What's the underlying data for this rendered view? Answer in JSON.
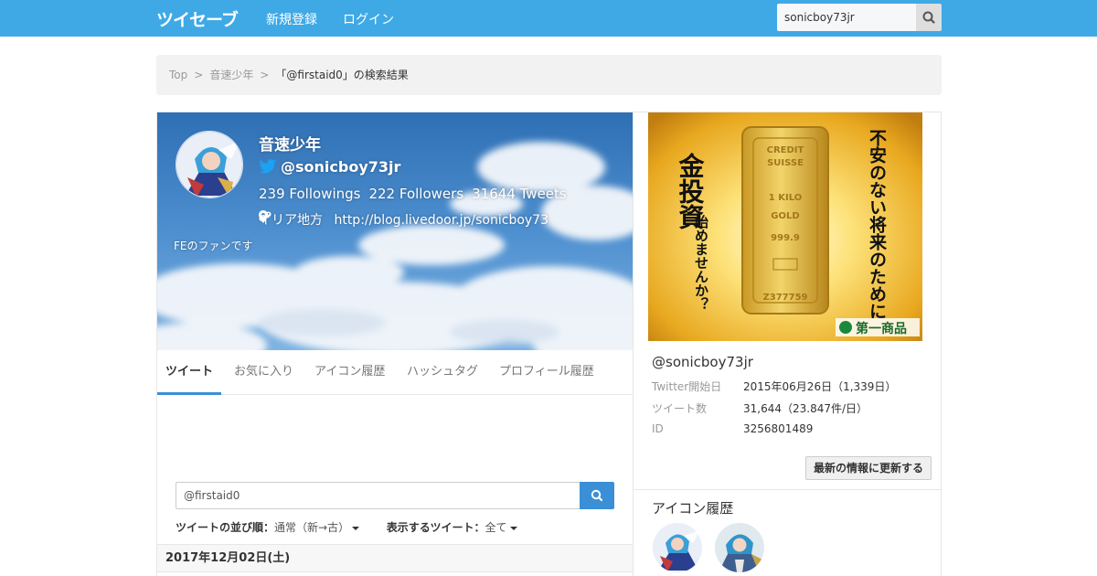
{
  "topbar": {
    "logo_text": "ツイセーブ",
    "nav": [
      "新規登録",
      "ログイン"
    ],
    "search_value": "sonicboy73jr",
    "colors": {
      "bar": "#3fa9e6"
    }
  },
  "breadcrumb": {
    "items": [
      "Top",
      "音速少年"
    ],
    "separator": ">",
    "current": "「@firstaid0」の検索結果"
  },
  "profile": {
    "name": "音速少年",
    "handle": "@sonicboy73jr",
    "followings": "239 Followings",
    "followers": "222 Followers",
    "tweets": "31644 Tweets",
    "location": "イリア地方",
    "url": "http://blog.livedoor.jp/sonicboy73",
    "bio": "FEのファンです"
  },
  "tabs": [
    {
      "label": "ツイート",
      "active": true
    },
    {
      "label": "お気に入り",
      "active": false
    },
    {
      "label": "アイコン履歴",
      "active": false
    },
    {
      "label": "ハッシュタグ",
      "active": false
    },
    {
      "label": "プロフィール履歴",
      "active": false
    }
  ],
  "filter": {
    "search_value": "@firstaid0",
    "order_label": "ツイートの並び順：",
    "order_value": "通常（新→古）",
    "show_label": "表示するツイート：",
    "show_value": "全て"
  },
  "date_header": "2017年12月02日(土)",
  "ad": {
    "left_text": "金投資",
    "left_sub": "始めませんか？",
    "right_text": "不安のない将来のために",
    "brand": "第一商品",
    "bar_engraving": [
      "CREDIT",
      "SUISSE",
      "1 KILO",
      "GOLD",
      "999.9",
      "Z377759"
    ]
  },
  "sidebar": {
    "handle": "@sonicboy73jr",
    "info": [
      {
        "label": "Twitter開始日",
        "value": "2015年06月26日（1,339日）"
      },
      {
        "label": "ツイート数",
        "value": "31,644（23.847件/日）"
      },
      {
        "label": "ID",
        "value": "3256801489"
      }
    ],
    "update_button": "最新の情報に更新する",
    "icon_history_title": "アイコン履歴"
  }
}
